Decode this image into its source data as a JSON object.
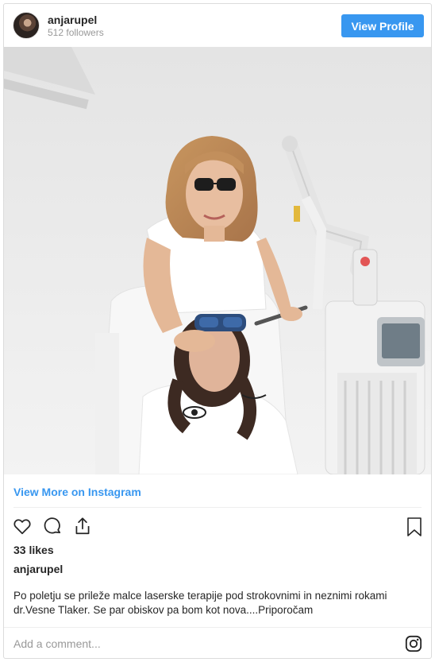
{
  "header": {
    "username": "anjarupel",
    "followers": "512 followers",
    "view_profile_label": "View Profile"
  },
  "post": {
    "view_more_label": "View More on Instagram",
    "likes": "33 likes",
    "caption_username": "anjarupel",
    "caption_text": "Po poletju se prileže malce laserske terapije pod strokovnimi in neznimi rokami dr.Vesne Tlaker. Se par obiskov pa bom kot nova....Priporočam"
  },
  "comment": {
    "placeholder": "Add a comment..."
  },
  "colors": {
    "accent": "#3897f0",
    "muted": "#999999",
    "text": "#262626"
  },
  "icons": [
    "heart-icon",
    "comment-icon",
    "share-icon",
    "bookmark-icon",
    "instagram-icon"
  ]
}
